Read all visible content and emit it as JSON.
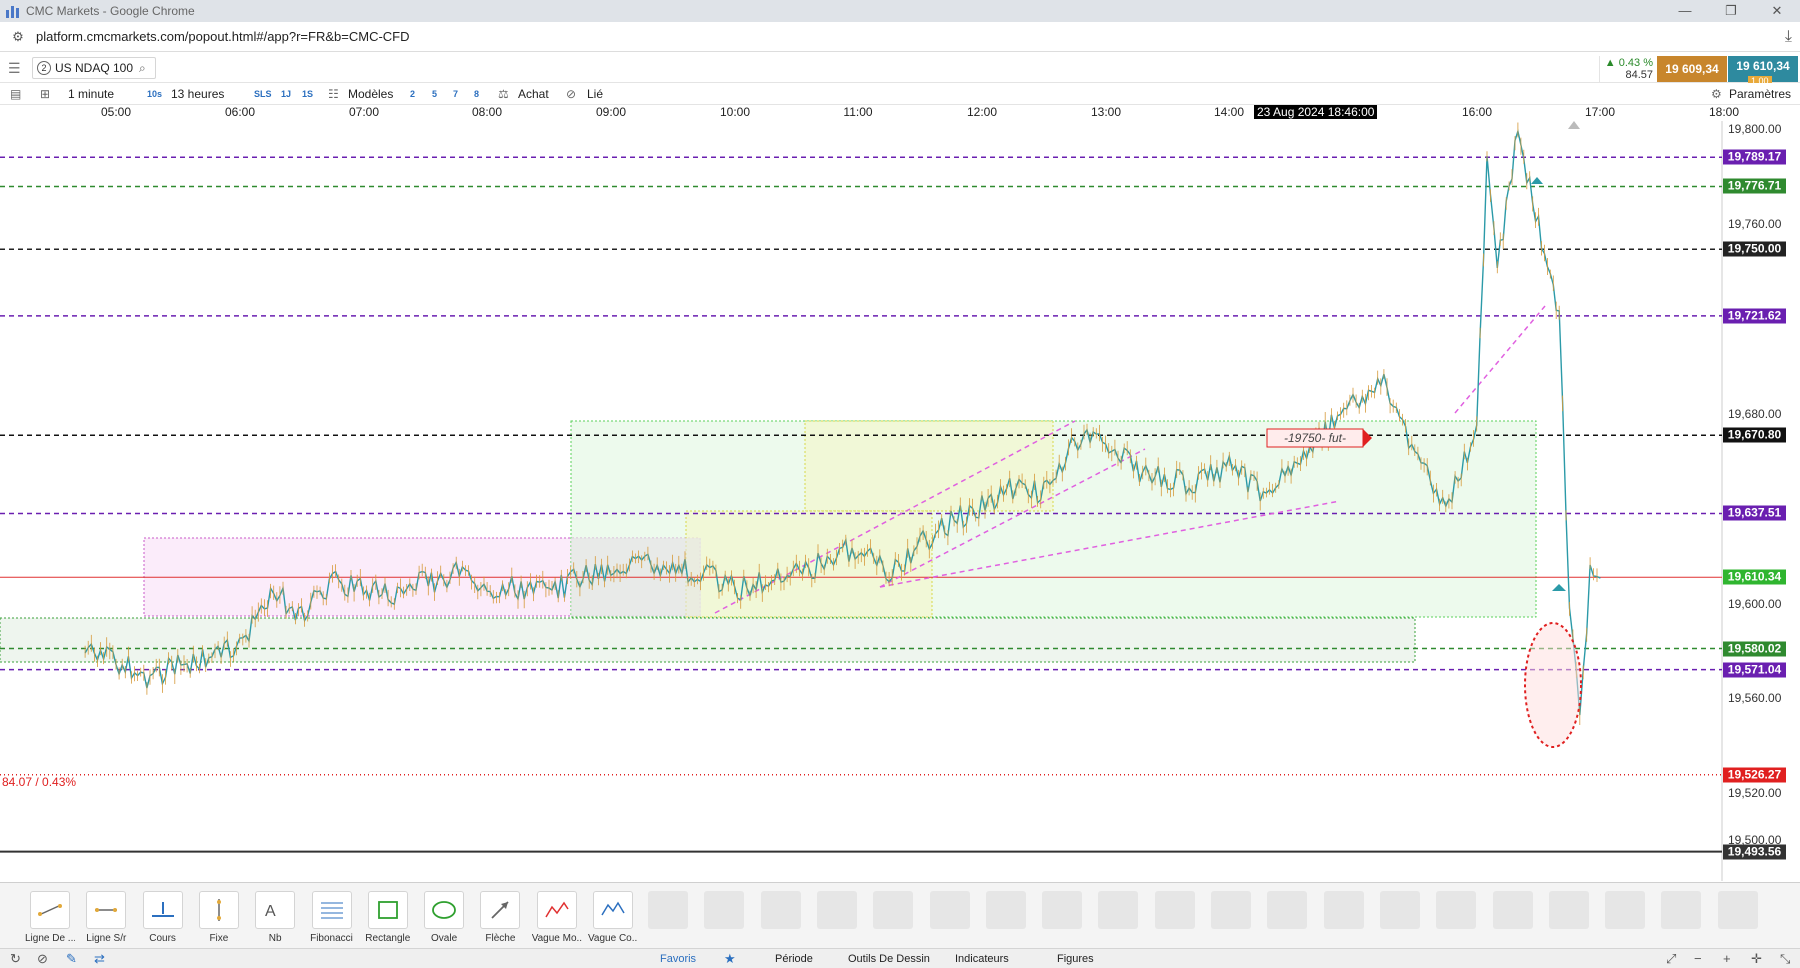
{
  "window": {
    "title": "CMC Markets - Google Chrome"
  },
  "address_bar": {
    "url": "platform.cmcmarkets.com/popout.html#/app?r=FR&b=CMC-CFD"
  },
  "instrument": {
    "number": "2",
    "name": "US NDAQ 100"
  },
  "quote": {
    "change_pct": "▲ 0.43 %",
    "change_pts": "84.57",
    "sell": "19 609,34",
    "buy": "19 610,34",
    "spread": "1.00"
  },
  "toolbar": {
    "timeframe": "1 minute",
    "t10s": "10s",
    "duration": "13 heures",
    "sls": "SLS",
    "j1": "1J",
    "s1": "1S",
    "models": "Modèles",
    "n2": "2",
    "n5": "5",
    "n7": "7",
    "n8": "8",
    "buy": "Achat",
    "linked": "Lié",
    "settings": "Paramètres"
  },
  "time_axis": {
    "labels": [
      "05:00",
      "06:00",
      "07:00",
      "08:00",
      "09:00",
      "10:00",
      "11:00",
      "12:00",
      "13:00",
      "14:00",
      "16:00",
      "17:00",
      "18:00"
    ],
    "crosshair": "23 Aug 2024 18:46:00"
  },
  "price_axis": {
    "labels": [
      "19,800.00",
      "19,760.00",
      "19,680.00",
      "19,600.00",
      "19,560.00",
      "19,520.00",
      "19,500.00"
    ]
  },
  "chart_data": {
    "type": "candlestick",
    "instrument": "US NDAQ 100",
    "interval": "1 minute",
    "date": "23 Aug 2024",
    "y_range": [
      19490,
      19805
    ],
    "x_range": [
      "04:45",
      "18:00"
    ],
    "current_price": 19610.34,
    "horizontal_levels": [
      {
        "value": 19789.17,
        "label": "19,789.17",
        "style": "dashed",
        "color": "#6a1fb0"
      },
      {
        "value": 19776.71,
        "label": "19,776.71",
        "style": "dashed",
        "color": "#2f8a2f"
      },
      {
        "value": 19750.0,
        "label": "19,750.00",
        "style": "dashed",
        "color": "#222222"
      },
      {
        "value": 19721.62,
        "label": "19,721.62",
        "style": "dashed",
        "color": "#6a1fb0"
      },
      {
        "value": 19670.8,
        "label": "19,670.80",
        "style": "dashed",
        "color": "#111111"
      },
      {
        "value": 19637.51,
        "label": "19,637.51",
        "style": "dashed",
        "color": "#6a1fb0"
      },
      {
        "value": 19610.34,
        "label": "19,610.34",
        "style": "solid",
        "color": "#2fb52f"
      },
      {
        "value": 19580.02,
        "label": "19,580.02",
        "style": "dashed",
        "color": "#2f8a2f"
      },
      {
        "value": 19571.04,
        "label": "19,571.04",
        "style": "dashed",
        "color": "#6a1fb0"
      },
      {
        "value": 19526.27,
        "label": "19,526.27",
        "style": "dotted",
        "color": "#e02020"
      },
      {
        "value": 19493.56,
        "label": "19,493.56",
        "style": "solid",
        "color": "#333333"
      }
    ],
    "annotations": {
      "change_label": "84.07 / 0.43%",
      "fut_label": "-19750- fut-"
    },
    "price_path": [
      [
        "04:45",
        19578
      ],
      [
        "05:00",
        19575
      ],
      [
        "05:15",
        19568
      ],
      [
        "05:30",
        19572
      ],
      [
        "05:45",
        19576
      ],
      [
        "06:00",
        19580
      ],
      [
        "06:15",
        19605
      ],
      [
        "06:30",
        19595
      ],
      [
        "06:45",
        19608
      ],
      [
        "07:00",
        19606
      ],
      [
        "07:15",
        19603
      ],
      [
        "07:30",
        19608
      ],
      [
        "07:45",
        19612
      ],
      [
        "08:00",
        19604
      ],
      [
        "08:15",
        19606
      ],
      [
        "08:30",
        19603
      ],
      [
        "08:45",
        19611
      ],
      [
        "09:00",
        19614
      ],
      [
        "09:15",
        19616
      ],
      [
        "09:30",
        19615
      ],
      [
        "09:45",
        19612
      ],
      [
        "10:00",
        19605
      ],
      [
        "10:15",
        19609
      ],
      [
        "10:30",
        19612
      ],
      [
        "10:45",
        19617
      ],
      [
        "11:00",
        19624
      ],
      [
        "11:15",
        19610
      ],
      [
        "11:30",
        19624
      ],
      [
        "11:45",
        19634
      ],
      [
        "12:00",
        19641
      ],
      [
        "12:15",
        19648
      ],
      [
        "12:30",
        19647
      ],
      [
        "12:45",
        19668
      ],
      [
        "13:00",
        19668
      ],
      [
        "13:15",
        19656
      ],
      [
        "13:30",
        19651
      ],
      [
        "13:45",
        19651
      ],
      [
        "14:00",
        19657
      ],
      [
        "14:15",
        19648
      ],
      [
        "14:30",
        19656
      ],
      [
        "14:45",
        19670
      ],
      [
        "15:00",
        19684
      ],
      [
        "15:15",
        19693
      ],
      [
        "15:30",
        19665
      ],
      [
        "15:45",
        19637
      ],
      [
        "16:00",
        19675
      ],
      [
        "16:05",
        19790
      ],
      [
        "16:10",
        19740
      ],
      [
        "16:20",
        19800
      ],
      [
        "16:30",
        19760
      ],
      [
        "16:40",
        19720
      ],
      [
        "16:45",
        19600
      ],
      [
        "16:50",
        19550
      ],
      [
        "16:55",
        19612
      ],
      [
        "17:00",
        19610
      ]
    ]
  },
  "drawing_tools": [
    {
      "label": "Ligne De ...",
      "icon": "trend-line-icon"
    },
    {
      "label": "Ligne S/r",
      "icon": "sr-line-icon"
    },
    {
      "label": "Cours",
      "icon": "price-line-icon"
    },
    {
      "label": "Fixe",
      "icon": "fixed-line-icon"
    },
    {
      "label": "Nb",
      "icon": "text-note-icon"
    },
    {
      "label": "Fibonacci",
      "icon": "fibonacci-icon"
    },
    {
      "label": "Rectangle",
      "icon": "rectangle-icon"
    },
    {
      "label": "Ovale",
      "icon": "oval-icon"
    },
    {
      "label": "Flèche",
      "icon": "arrow-icon"
    },
    {
      "label": "Vague Mo...",
      "icon": "motive-wave-icon"
    },
    {
      "label": "Vague Co...",
      "icon": "corrective-wave-icon"
    }
  ],
  "bottom_tabs": {
    "favoris": "Favoris",
    "periode": "Période",
    "outils": "Outils De Dessin",
    "indicateurs": "Indicateurs",
    "figures": "Figures"
  }
}
